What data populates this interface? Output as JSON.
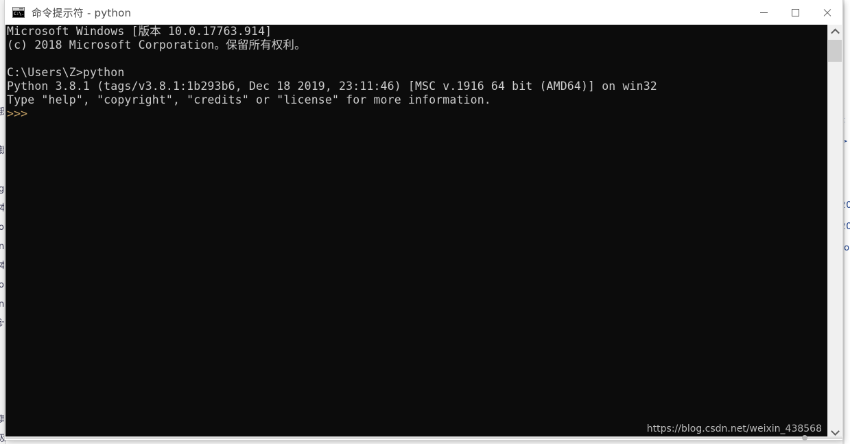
{
  "window": {
    "title": "命令提示符 - python",
    "icon": "cmd-icon",
    "icon_glyph": "C:\\.",
    "controls": {
      "minimize_label": "最小化",
      "maximize_label": "最大化",
      "close_label": "关闭"
    }
  },
  "terminal": {
    "background_color": "#0c0c0c",
    "foreground_color": "#cccccc",
    "prompt_color": "#c5a165",
    "lines": [
      "Microsoft Windows [版本 10.0.17763.914]",
      "(c) 2018 Microsoft Corporation。保留所有权利。",
      "",
      "C:\\Users\\Z>python",
      "Python 3.8.1 (tags/v3.8.1:1b293b6, Dec 18 2019, 23:11:46) [MSC v.1916 64 bit (AMD64)] on win32",
      "Type \"help\", \"copyright\", \"credits\" or \"license\" for more information.",
      ">>>"
    ],
    "full_text": "Microsoft Windows [版本 10.0.17763.914]\n(c) 2018 Microsoft Corporation。保留所有权利。\n\nC:\\Users\\Z>python\nPython 3.8.1 (tags/v3.8.1:1b293b6, Dec 18 2019, 23:11:46) [MSC v.1916 64 bit (AMD64)] on win32\nType \"help\", \"copyright\", \"credits\" or \"license\" for more information.\n",
    "prompt": ">>>",
    "watermark": "https://blog.csdn.net/weixin_438568"
  },
  "scrollbar": {
    "up_arrow": "▲",
    "down_arrow": "▼",
    "thumb_position_percent": 4
  },
  "background": {
    "left_fragment": "我\n\n锁\n\ng\n本\no\nnp\n本\no\nnp\n计,\n\n\n\n\n其\n及",
    "right_fragment": "c\n>\n\n\n20\n20\nto\n\n,"
  }
}
